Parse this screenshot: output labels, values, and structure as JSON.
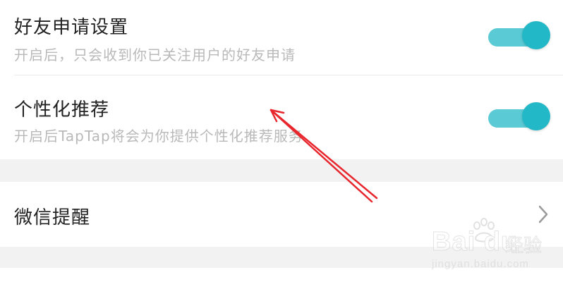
{
  "settings": {
    "friend_request": {
      "title": "好友申请设置",
      "description": "开启后，只会收到你已关注用户的好友申请",
      "enabled": true
    },
    "personalized_recommendation": {
      "title": "个性化推荐",
      "description": "开启后TapTap将会为你提供个性化推荐服务",
      "enabled": true
    },
    "wechat_reminder": {
      "title": "微信提醒"
    }
  },
  "colors": {
    "toggle_on": "#23b8c7",
    "annotation_arrow": "#e8262d",
    "background": "#f2f2f2"
  },
  "watermark": {
    "brand": "Bai du",
    "jingyan": "经验",
    "url": "jingyan.baidu.com"
  }
}
